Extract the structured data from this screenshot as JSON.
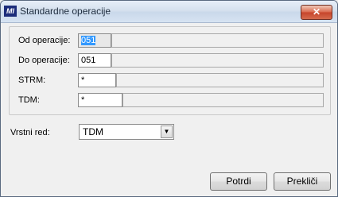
{
  "window": {
    "title": "Standardne operacije",
    "icon_text": "MI",
    "close_symbol": "✕"
  },
  "fields": [
    {
      "label": "Od operacije:",
      "value": "051"
    },
    {
      "label": "Do operacije:",
      "value": "051"
    },
    {
      "label": "STRM:",
      "value": "*"
    },
    {
      "label": "TDM:",
      "value": "*"
    }
  ],
  "order": {
    "label": "Vrstni red:",
    "selected": "TDM",
    "arrow": "▼"
  },
  "buttons": {
    "confirm": "Potrdi",
    "cancel": "Prekliči"
  }
}
